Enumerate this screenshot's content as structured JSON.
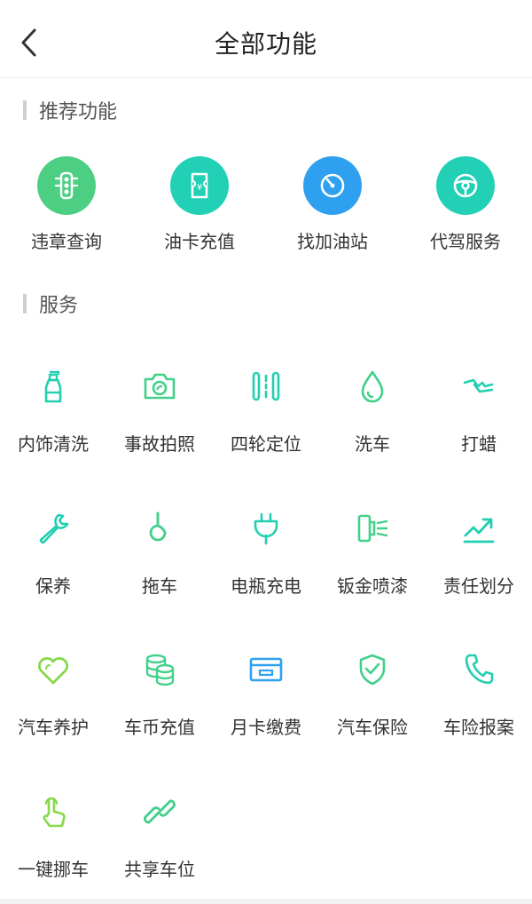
{
  "header": {
    "title": "全部功能"
  },
  "recommended": {
    "title": "推荐功能",
    "items": [
      {
        "label": "违章查询",
        "icon": "traffic-light-icon",
        "color": "#4ccf82"
      },
      {
        "label": "油卡充值",
        "icon": "fuel-card-icon",
        "color": "#22d0b6"
      },
      {
        "label": "找加油站",
        "icon": "gauge-icon",
        "color": "#2fa0ef"
      },
      {
        "label": "代驾服务",
        "icon": "steering-wheel-icon",
        "color": "#22d0b6"
      }
    ]
  },
  "services": {
    "title": "服务",
    "items": [
      {
        "label": "内饰清洗",
        "icon": "spray-bottle-icon",
        "color": "#22cfb0"
      },
      {
        "label": "事故拍照",
        "icon": "camera-icon",
        "color": "#42d08a"
      },
      {
        "label": "四轮定位",
        "icon": "wheel-alignment-icon",
        "color": "#22cfb0"
      },
      {
        "label": "洗车",
        "icon": "water-drop-icon",
        "color": "#42d08a"
      },
      {
        "label": "打蜡",
        "icon": "wax-icon",
        "color": "#22cfb0"
      },
      {
        "label": "保养",
        "icon": "wrench-icon",
        "color": "#22cfb0"
      },
      {
        "label": "拖车",
        "icon": "tow-hook-icon",
        "color": "#42d08a"
      },
      {
        "label": "电瓶充电",
        "icon": "plug-icon",
        "color": "#22cfb0"
      },
      {
        "label": "钣金喷漆",
        "icon": "spray-gun-icon",
        "color": "#42d08a"
      },
      {
        "label": "责任划分",
        "icon": "trend-icon",
        "color": "#22cfb0"
      },
      {
        "label": "汽车养护",
        "icon": "heart-icon",
        "color": "#86d84a"
      },
      {
        "label": "车币充值",
        "icon": "coins-icon",
        "color": "#42d08a"
      },
      {
        "label": "月卡缴费",
        "icon": "card-icon",
        "color": "#2fa0ef"
      },
      {
        "label": "汽车保险",
        "icon": "shield-check-icon",
        "color": "#42d08a"
      },
      {
        "label": "车险报案",
        "icon": "phone-icon",
        "color": "#22cfb0"
      },
      {
        "label": "一键挪车",
        "icon": "hand-tap-icon",
        "color": "#86d84a"
      },
      {
        "label": "共享车位",
        "icon": "link-icon",
        "color": "#42d08a"
      }
    ]
  }
}
